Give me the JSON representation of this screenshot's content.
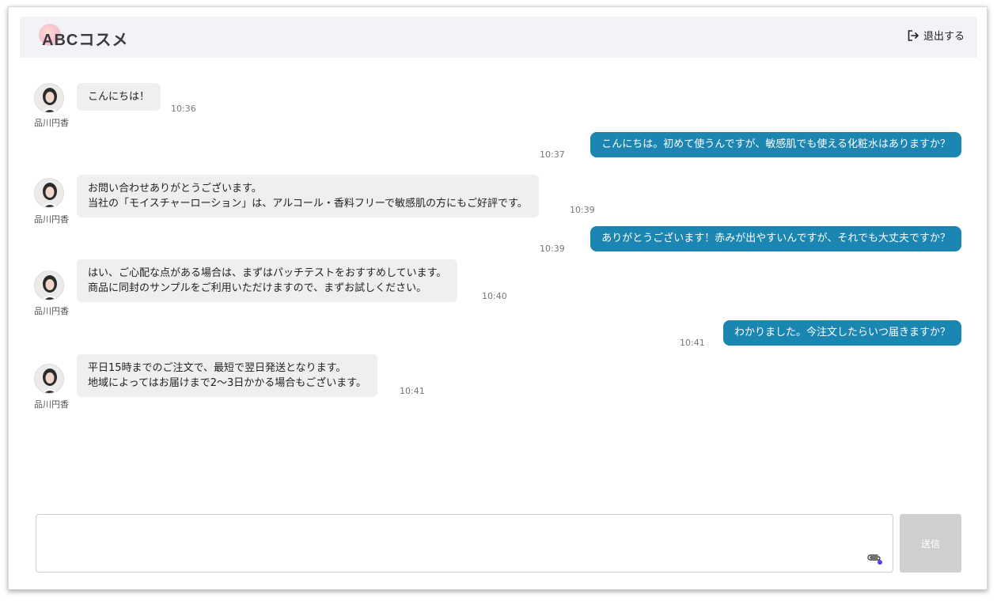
{
  "header": {
    "logo_text": "ABCコスメ",
    "logout_label": "退出する"
  },
  "messages": [
    {
      "side": "agent",
      "name": "品川円香",
      "lines": [
        "こんにちは！"
      ],
      "time": "10:36"
    },
    {
      "side": "user",
      "text": "こんにちは。初めて使うんですが、敏感肌でも使える化粧水はありますか？",
      "time": "10:37"
    },
    {
      "side": "agent",
      "name": "品川円香",
      "lines": [
        "お問い合わせありがとうございます。",
        "当社の「モイスチャーローション」は、アルコール・香料フリーで敏感肌の方にもご好評です。"
      ],
      "time": "10:39"
    },
    {
      "side": "user",
      "text": "ありがとうございます！赤みが出やすいんですが、それでも大丈夫ですか？",
      "time": "10:39"
    },
    {
      "side": "agent",
      "name": "品川円香",
      "lines": [
        "はい、ご心配な点がある場合は、まずはパッチテストをおすすめしています。",
        "商品に同封のサンプルをご利用いただけますので、まずお試しください。"
      ],
      "time": "10:40"
    },
    {
      "side": "user",
      "text": "わかりました。今注文したらいつ届きますか？",
      "time": "10:41"
    },
    {
      "side": "agent",
      "name": "品川円香",
      "lines": [
        "平日15時までのご注文で、最短で翌日発送となります。",
        "地域によってはお届けまで2〜3日かかる場合もございます。"
      ],
      "time": "10:41"
    }
  ],
  "composer": {
    "value": "",
    "send_label": "送信"
  },
  "icons": {
    "logout": "logout-icon",
    "attach": "paperclip-icon",
    "avatar": "agent-avatar"
  },
  "colors": {
    "user_bubble": "#1c86b2",
    "agent_bubble": "#efefef",
    "header_bg": "#f1f3f6",
    "send_disabled": "#cfcfcf",
    "attach_dot": "#5b3df0"
  }
}
